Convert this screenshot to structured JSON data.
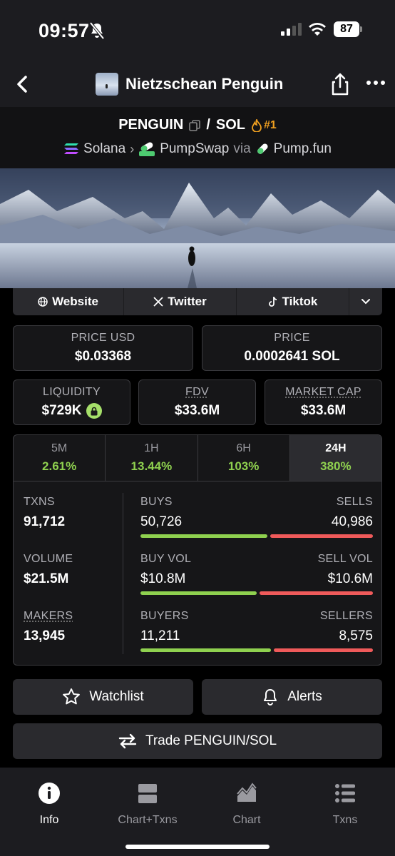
{
  "status": {
    "time": "09:57",
    "battery": "87"
  },
  "header": {
    "title": "Nietzschean Penguin"
  },
  "pair": {
    "base": "PENGUIN",
    "separator": "/",
    "quote": "SOL",
    "rank": "#1",
    "chain": "Solana",
    "dex": "PumpSwap",
    "via": "via",
    "launchpad": "Pump.fun",
    "swap_badge": "SWAP"
  },
  "socials": {
    "website": "Website",
    "twitter": "Twitter",
    "tiktok": "Tiktok"
  },
  "prices": {
    "price_usd_label": "PRICE USD",
    "price_usd": "$0.03368",
    "price_label": "PRICE",
    "price": "0.0002641 SOL",
    "liquidity_label": "LIQUIDITY",
    "liquidity": "$729K",
    "fdv_label": "FDV",
    "fdv": "$33.6M",
    "mcap_label": "MARKET CAP",
    "mcap": "$33.6M"
  },
  "timeframes": [
    {
      "label": "5M",
      "value": "2.61%"
    },
    {
      "label": "1H",
      "value": "13.44%"
    },
    {
      "label": "6H",
      "value": "103%"
    },
    {
      "label": "24H",
      "value": "380%"
    }
  ],
  "txn_stats": {
    "txns_label": "TXNS",
    "txns": "91,712",
    "volume_label": "VOLUME",
    "volume": "$21.5M",
    "makers_label": "MAKERS",
    "makers": "13,945",
    "buys_label": "BUYS",
    "buys": "50,726",
    "sells_label": "SELLS",
    "sells": "40,986",
    "buy_vol_label": "BUY VOL",
    "buy_vol": "$10.8M",
    "sell_vol_label": "SELL VOL",
    "sell_vol": "$10.6M",
    "buyers_label": "BUYERS",
    "buyers": "11,211",
    "sellers_label": "SELLERS",
    "sellers": "8,575",
    "buy_share_txns": 0.553,
    "buy_share_vol": 0.505,
    "buy_share_makers": 0.567
  },
  "actions": {
    "watchlist": "Watchlist",
    "alerts": "Alerts",
    "trade": "Trade PENGUIN/SOL"
  },
  "tabbar": [
    {
      "label": "Info",
      "icon": "info-icon"
    },
    {
      "label": "Chart+Txns",
      "icon": "split-icon"
    },
    {
      "label": "Chart",
      "icon": "area-chart-icon"
    },
    {
      "label": "Txns",
      "icon": "list-icon"
    }
  ],
  "colors": {
    "buy": "#8fd14f",
    "sell": "#ef5a5a",
    "rank": "#f0a020"
  }
}
